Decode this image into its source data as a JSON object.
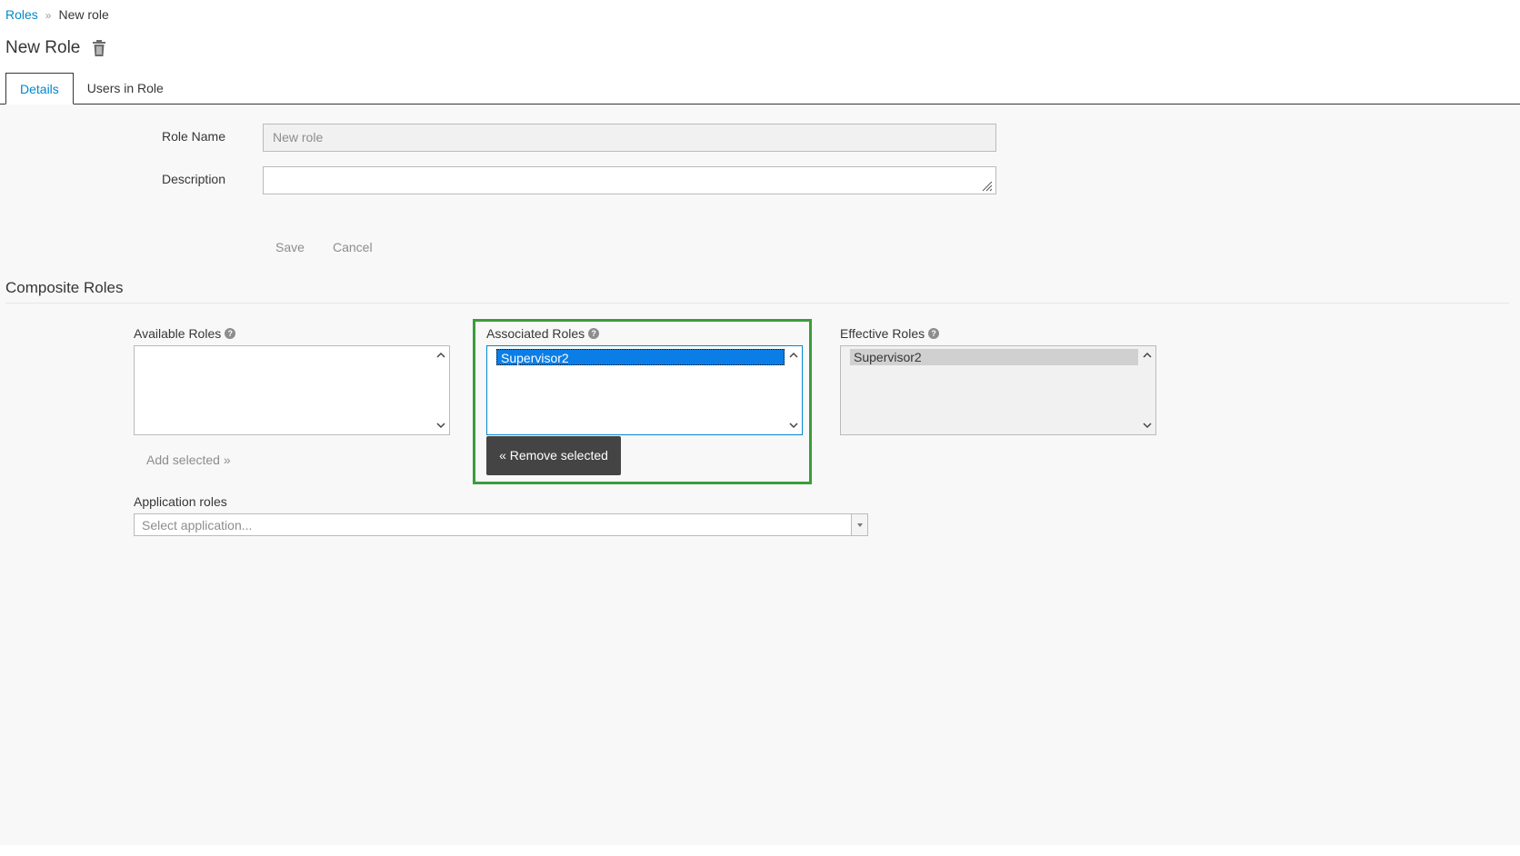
{
  "breadcrumb": {
    "parent": "Roles",
    "separator": "»",
    "current": "New role"
  },
  "page": {
    "title": "New Role",
    "delete_icon": "trash-icon"
  },
  "tabs": [
    {
      "label": "Details",
      "active": true
    },
    {
      "label": "Users in Role",
      "active": false
    }
  ],
  "form": {
    "role_name_label": "Role Name",
    "role_name_value": "New role",
    "description_label": "Description",
    "description_value": "",
    "save_label": "Save",
    "cancel_label": "Cancel"
  },
  "composite": {
    "title": "Composite Roles",
    "available": {
      "label": "Available Roles",
      "items": [],
      "button": "Add selected »"
    },
    "associated": {
      "label": "Associated Roles",
      "items": [
        "Supervisor2"
      ],
      "selected": "Supervisor2",
      "button": "« Remove selected"
    },
    "effective": {
      "label": "Effective Roles",
      "items": [
        "Supervisor2"
      ]
    },
    "application_roles_label": "Application roles",
    "application_placeholder": "Select application..."
  },
  "colors": {
    "link": "#0088ce",
    "selected_option": "#0a7ee6",
    "dark_button": "#444444",
    "highlight_border": "#3a9d3a"
  }
}
